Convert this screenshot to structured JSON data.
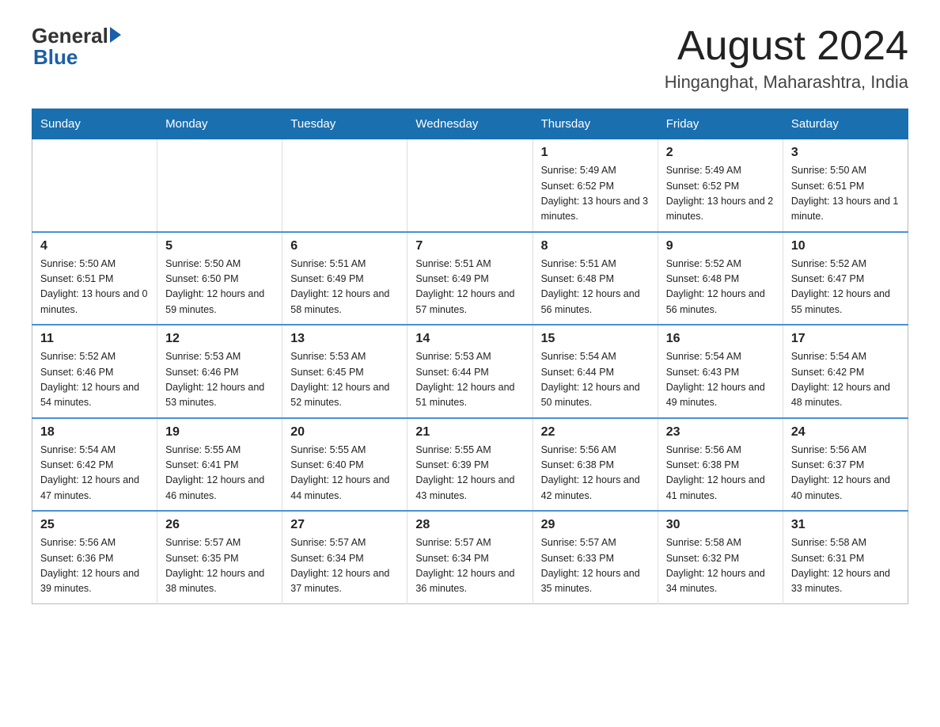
{
  "logo": {
    "general": "General",
    "blue": "Blue"
  },
  "title": "August 2024",
  "subtitle": "Hinganghat, Maharashtra, India",
  "days_of_week": [
    "Sunday",
    "Monday",
    "Tuesday",
    "Wednesday",
    "Thursday",
    "Friday",
    "Saturday"
  ],
  "weeks": [
    [
      {
        "day": "",
        "info": ""
      },
      {
        "day": "",
        "info": ""
      },
      {
        "day": "",
        "info": ""
      },
      {
        "day": "",
        "info": ""
      },
      {
        "day": "1",
        "info": "Sunrise: 5:49 AM\nSunset: 6:52 PM\nDaylight: 13 hours\nand 3 minutes."
      },
      {
        "day": "2",
        "info": "Sunrise: 5:49 AM\nSunset: 6:52 PM\nDaylight: 13 hours\nand 2 minutes."
      },
      {
        "day": "3",
        "info": "Sunrise: 5:50 AM\nSunset: 6:51 PM\nDaylight: 13 hours\nand 1 minute."
      }
    ],
    [
      {
        "day": "4",
        "info": "Sunrise: 5:50 AM\nSunset: 6:51 PM\nDaylight: 13 hours\nand 0 minutes."
      },
      {
        "day": "5",
        "info": "Sunrise: 5:50 AM\nSunset: 6:50 PM\nDaylight: 12 hours\nand 59 minutes."
      },
      {
        "day": "6",
        "info": "Sunrise: 5:51 AM\nSunset: 6:49 PM\nDaylight: 12 hours\nand 58 minutes."
      },
      {
        "day": "7",
        "info": "Sunrise: 5:51 AM\nSunset: 6:49 PM\nDaylight: 12 hours\nand 57 minutes."
      },
      {
        "day": "8",
        "info": "Sunrise: 5:51 AM\nSunset: 6:48 PM\nDaylight: 12 hours\nand 56 minutes."
      },
      {
        "day": "9",
        "info": "Sunrise: 5:52 AM\nSunset: 6:48 PM\nDaylight: 12 hours\nand 56 minutes."
      },
      {
        "day": "10",
        "info": "Sunrise: 5:52 AM\nSunset: 6:47 PM\nDaylight: 12 hours\nand 55 minutes."
      }
    ],
    [
      {
        "day": "11",
        "info": "Sunrise: 5:52 AM\nSunset: 6:46 PM\nDaylight: 12 hours\nand 54 minutes."
      },
      {
        "day": "12",
        "info": "Sunrise: 5:53 AM\nSunset: 6:46 PM\nDaylight: 12 hours\nand 53 minutes."
      },
      {
        "day": "13",
        "info": "Sunrise: 5:53 AM\nSunset: 6:45 PM\nDaylight: 12 hours\nand 52 minutes."
      },
      {
        "day": "14",
        "info": "Sunrise: 5:53 AM\nSunset: 6:44 PM\nDaylight: 12 hours\nand 51 minutes."
      },
      {
        "day": "15",
        "info": "Sunrise: 5:54 AM\nSunset: 6:44 PM\nDaylight: 12 hours\nand 50 minutes."
      },
      {
        "day": "16",
        "info": "Sunrise: 5:54 AM\nSunset: 6:43 PM\nDaylight: 12 hours\nand 49 minutes."
      },
      {
        "day": "17",
        "info": "Sunrise: 5:54 AM\nSunset: 6:42 PM\nDaylight: 12 hours\nand 48 minutes."
      }
    ],
    [
      {
        "day": "18",
        "info": "Sunrise: 5:54 AM\nSunset: 6:42 PM\nDaylight: 12 hours\nand 47 minutes."
      },
      {
        "day": "19",
        "info": "Sunrise: 5:55 AM\nSunset: 6:41 PM\nDaylight: 12 hours\nand 46 minutes."
      },
      {
        "day": "20",
        "info": "Sunrise: 5:55 AM\nSunset: 6:40 PM\nDaylight: 12 hours\nand 44 minutes."
      },
      {
        "day": "21",
        "info": "Sunrise: 5:55 AM\nSunset: 6:39 PM\nDaylight: 12 hours\nand 43 minutes."
      },
      {
        "day": "22",
        "info": "Sunrise: 5:56 AM\nSunset: 6:38 PM\nDaylight: 12 hours\nand 42 minutes."
      },
      {
        "day": "23",
        "info": "Sunrise: 5:56 AM\nSunset: 6:38 PM\nDaylight: 12 hours\nand 41 minutes."
      },
      {
        "day": "24",
        "info": "Sunrise: 5:56 AM\nSunset: 6:37 PM\nDaylight: 12 hours\nand 40 minutes."
      }
    ],
    [
      {
        "day": "25",
        "info": "Sunrise: 5:56 AM\nSunset: 6:36 PM\nDaylight: 12 hours\nand 39 minutes."
      },
      {
        "day": "26",
        "info": "Sunrise: 5:57 AM\nSunset: 6:35 PM\nDaylight: 12 hours\nand 38 minutes."
      },
      {
        "day": "27",
        "info": "Sunrise: 5:57 AM\nSunset: 6:34 PM\nDaylight: 12 hours\nand 37 minutes."
      },
      {
        "day": "28",
        "info": "Sunrise: 5:57 AM\nSunset: 6:34 PM\nDaylight: 12 hours\nand 36 minutes."
      },
      {
        "day": "29",
        "info": "Sunrise: 5:57 AM\nSunset: 6:33 PM\nDaylight: 12 hours\nand 35 minutes."
      },
      {
        "day": "30",
        "info": "Sunrise: 5:58 AM\nSunset: 6:32 PM\nDaylight: 12 hours\nand 34 minutes."
      },
      {
        "day": "31",
        "info": "Sunrise: 5:58 AM\nSunset: 6:31 PM\nDaylight: 12 hours\nand 33 minutes."
      }
    ]
  ]
}
